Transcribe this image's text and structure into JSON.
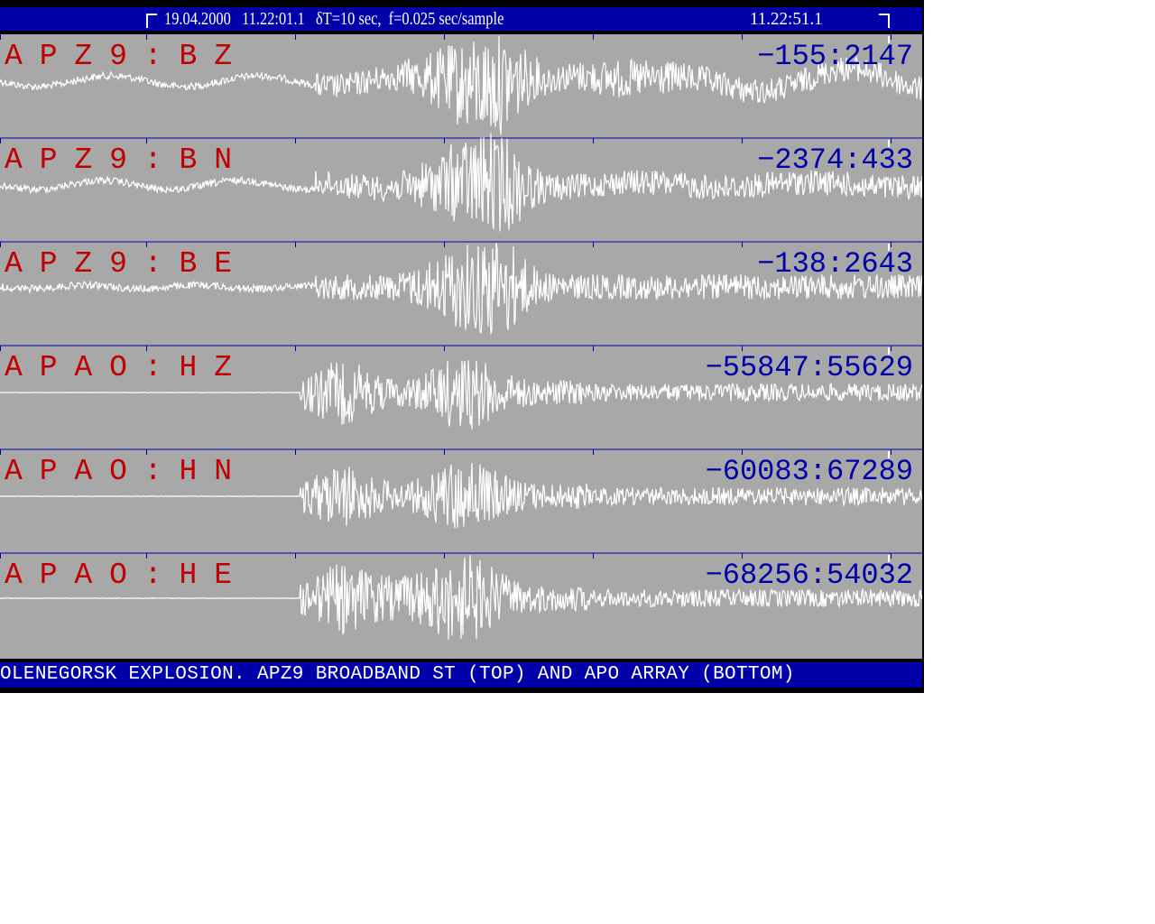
{
  "header": {
    "left_text": "19.04.2000   11.22:01.1   δT=10 sec,  f=0.025 sec/sample",
    "right_text": "11.22:51.1"
  },
  "channels": [
    {
      "label": "APZ9:BZ",
      "range": "−155:2147"
    },
    {
      "label": "APZ9:BN",
      "range": "−2374:433"
    },
    {
      "label": "APZ9:BE",
      "range": "−138:2643"
    },
    {
      "label": "APAO:HZ",
      "range": "−55847:55629"
    },
    {
      "label": "APAO:HN",
      "range": "−60083:67289"
    },
    {
      "label": "APAO:HE",
      "range": "−68256:54032"
    }
  ],
  "footer": {
    "caption": "OLENEGORSK EXPLOSION. APZ9 BROADBAND ST (TOP) AND APO ARRAY (BOTTOM)"
  },
  "colors": {
    "background": "#a8a8a8",
    "bar": "#0000a8",
    "label": "#c00000",
    "range": "#0000a8",
    "trace": "#ffffff",
    "separator": "#0000a8"
  }
}
